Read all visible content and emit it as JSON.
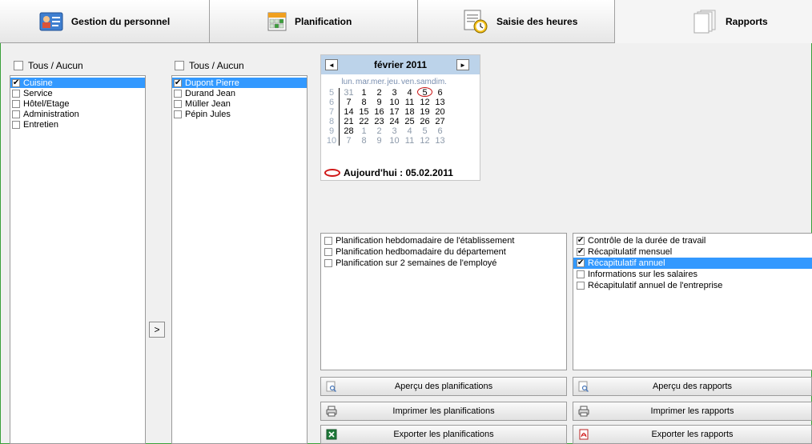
{
  "tabs": [
    {
      "label": "Gestion du personnel",
      "icon": "staff-id-card-icon"
    },
    {
      "label": "Planification",
      "icon": "planning-grid-icon"
    },
    {
      "label": "Saisie des heures",
      "icon": "clock-document-icon"
    },
    {
      "label": "Rapports",
      "icon": "report-pages-icon"
    }
  ],
  "departments": {
    "all_label": "Tous / Aucun",
    "items": [
      {
        "label": "Cuisine",
        "checked": true,
        "selected": true
      },
      {
        "label": "Service",
        "checked": false
      },
      {
        "label": "Hôtel/Etage",
        "checked": false
      },
      {
        "label": "Administration",
        "checked": false
      },
      {
        "label": "Entretien",
        "checked": false
      }
    ]
  },
  "employees": {
    "all_label": "Tous / Aucun",
    "items": [
      {
        "label": "Dupont Pierre",
        "checked": true,
        "selected": true
      },
      {
        "label": "Durand Jean",
        "checked": false
      },
      {
        "label": "Müller Jean",
        "checked": false
      },
      {
        "label": "Pépin Jules",
        "checked": false
      }
    ]
  },
  "transfer_button": ">",
  "calendar": {
    "title": "février 2011",
    "prev": "◄",
    "next": "►",
    "weekdays": [
      "lun.",
      "mar.",
      "mer.",
      "jeu.",
      "ven.",
      "sam.",
      "dim."
    ],
    "weeks": [
      {
        "wk": "5",
        "days": [
          "31",
          "1",
          "2",
          "3",
          "4",
          "5",
          "6"
        ]
      },
      {
        "wk": "6",
        "days": [
          "7",
          "8",
          "9",
          "10",
          "11",
          "12",
          "13"
        ]
      },
      {
        "wk": "7",
        "days": [
          "14",
          "15",
          "16",
          "17",
          "18",
          "19",
          "20"
        ]
      },
      {
        "wk": "8",
        "days": [
          "21",
          "22",
          "23",
          "24",
          "25",
          "26",
          "27"
        ]
      },
      {
        "wk": "9",
        "days": [
          "28",
          "1",
          "2",
          "3",
          "4",
          "5",
          "6"
        ]
      },
      {
        "wk": "10",
        "days": [
          "7",
          "8",
          "9",
          "10",
          "11",
          "12",
          "13"
        ]
      }
    ],
    "today_label": "Aujourd'hui : 05.02.2011"
  },
  "planning_reports": [
    {
      "label": "Planification hebdomadaire de l'établissement",
      "checked": false
    },
    {
      "label": "Planification hedbomadaire du département",
      "checked": false
    },
    {
      "label": "Planification sur 2 semaines de l'employé",
      "checked": false
    }
  ],
  "reports": [
    {
      "label": "Contrôle de la durée de travail",
      "checked": true
    },
    {
      "label": "Récapitulatif mensuel",
      "checked": true
    },
    {
      "label": "Récapitulatif annuel",
      "checked": true,
      "selected": true
    },
    {
      "label": "Informations sur les salaires",
      "checked": false
    },
    {
      "label": "Récapitulatif annuel de l'entreprise",
      "checked": false
    }
  ],
  "buttons": {
    "preview_planning": "Aperçu des planifications",
    "print_planning": "Imprimer les planifications",
    "export_planning": "Exporter les planifications",
    "preview_reports": "Aperçu des rapports",
    "print_reports": "Imprimer les rapports",
    "export_reports": "Exporter les rapports"
  }
}
